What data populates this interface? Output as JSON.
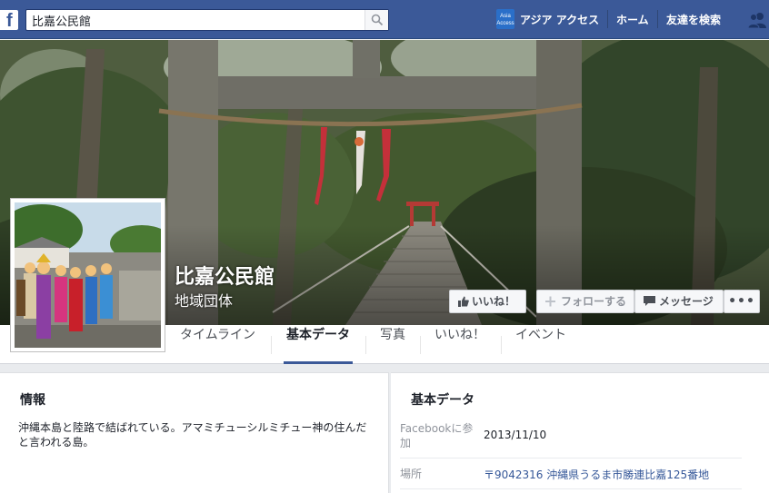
{
  "topbar": {
    "logo": "f",
    "search_value": "比嘉公民館",
    "search_icon": "search-icon",
    "user_badge": "Asia Access",
    "user_name": "アジア アクセス",
    "home_label": "ホーム",
    "find_friends_label": "友達を検索",
    "friend_requests_icon": "friend-requests-icon",
    "brand_color": "#3b5998"
  },
  "cover": {
    "page_name": "比嘉公民館",
    "category": "地域団体"
  },
  "actions": {
    "like_label": "いいね！",
    "follow_label": "フォローする",
    "message_label": "メッセージ",
    "more_label": "•••"
  },
  "tabs": [
    {
      "label": "タイムライン",
      "active": false
    },
    {
      "label": "基本データ",
      "active": true
    },
    {
      "label": "写真",
      "active": false
    },
    {
      "label": "いいね！",
      "active": false
    },
    {
      "label": "イベント",
      "active": false
    }
  ],
  "info": {
    "heading": "情報",
    "description": "沖縄本島と陸路で結ばれている。アマミチューシルミチュー神の住んだと言われる島。"
  },
  "basic_data": {
    "heading": "基本データ",
    "rows": [
      {
        "label": "Facebookに参加",
        "value": "2013/11/10",
        "is_link": false
      },
      {
        "label": "場所",
        "value": "〒9042316 沖縄県うるま市勝連比嘉125番地",
        "is_link": true
      }
    ]
  }
}
